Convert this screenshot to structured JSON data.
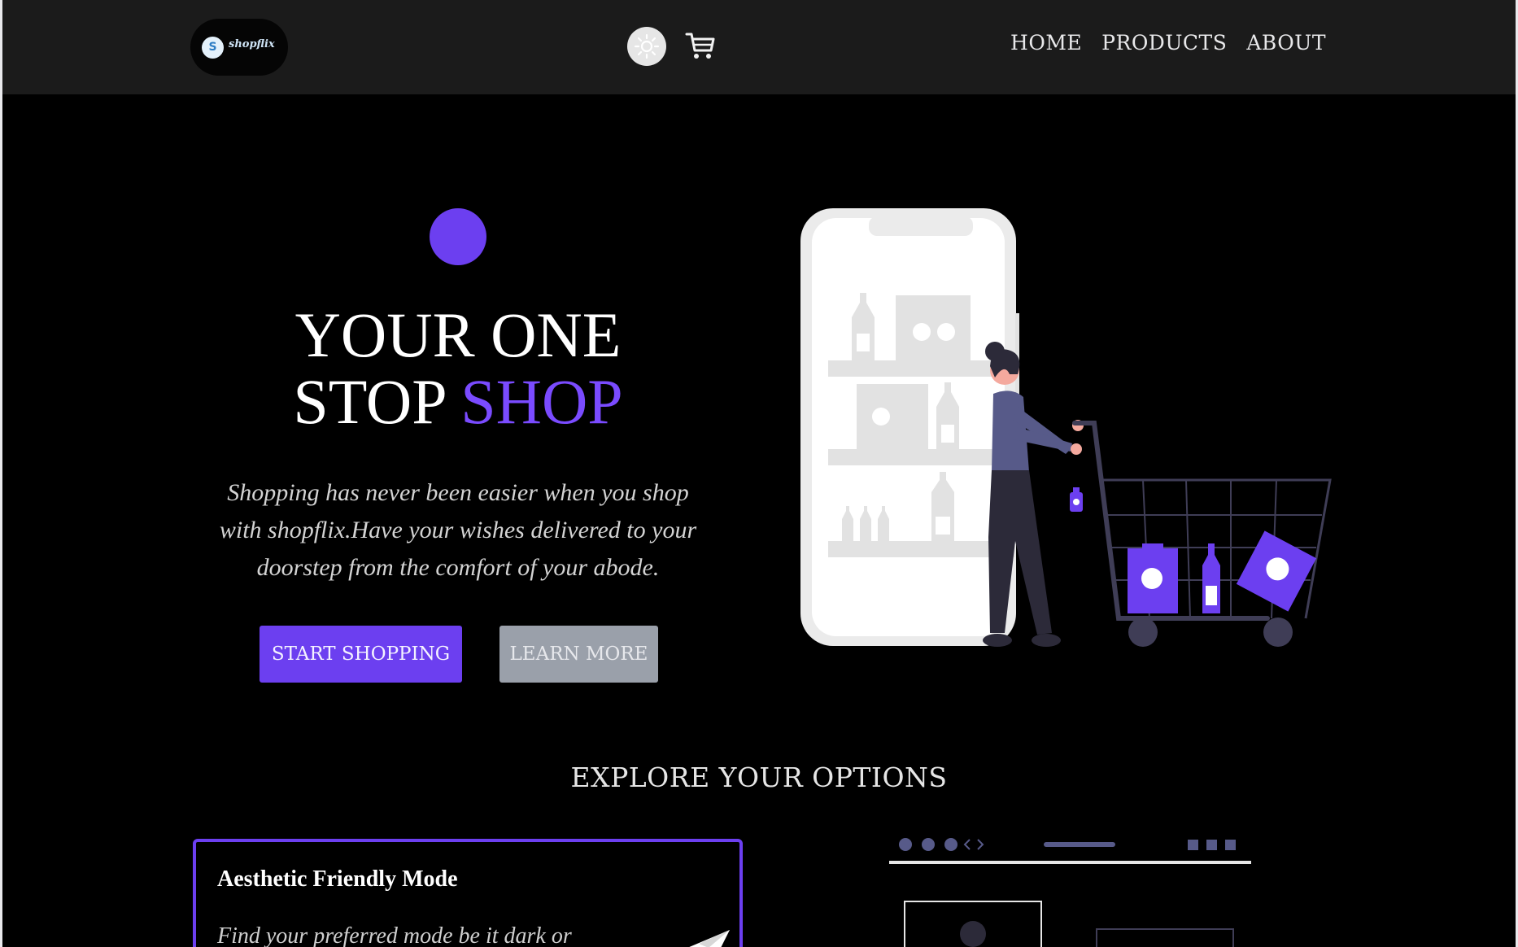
{
  "nav": {
    "logo_initial": "S",
    "logo_text": "shopflix",
    "links": [
      "HOME",
      "PRODUCTS",
      "ABOUT"
    ]
  },
  "hero": {
    "headline_line1": "YOUR ONE",
    "headline_line2_plain": "STOP ",
    "headline_line2_accent": "SHOP",
    "lead_lines": [
      "Shopping has never been easier when you shop",
      "with shopflix.Have your wishes delivered to your",
      "doorstep from the comfort of your abode."
    ],
    "primary_button": "START SHOPPING",
    "secondary_button": "LEARN MORE"
  },
  "explore": {
    "title": "EXPLORE YOUR OPTIONS",
    "card_title": "Aesthetic Friendly Mode",
    "card_text": "Find your preferred mode be it dark or"
  },
  "colors": {
    "accent": "#6c3ff0",
    "navbar": "#1b1b1b",
    "background": "#000000",
    "secondary_button": "#9aa0aa"
  },
  "icons": [
    "sun-icon",
    "shopping-cart-icon",
    "paper-plane-icon"
  ]
}
